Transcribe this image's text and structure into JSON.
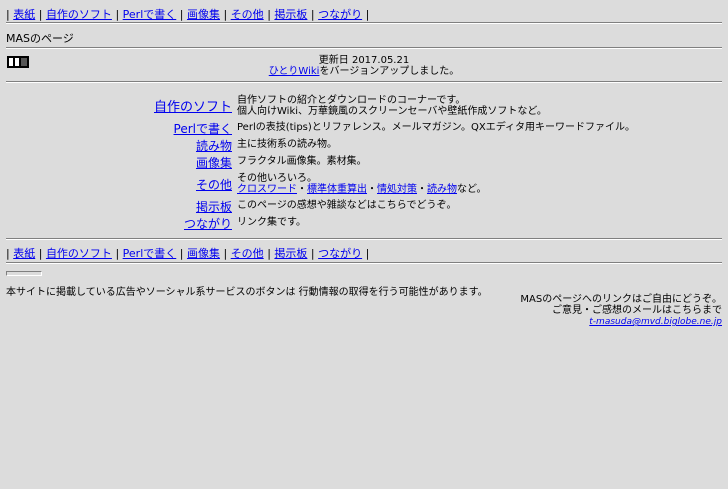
{
  "nav": {
    "items": [
      "表紙",
      "自作のソフト",
      "Perlで書く",
      "画像集",
      "その他",
      "掲示板",
      "つながり"
    ],
    "separator": "|"
  },
  "page_title": "MASのページ",
  "update": {
    "date_line": "更新日 2017.05.21",
    "link_text": "ひとりWiki",
    "message_rest": "をバージョンアップしました。"
  },
  "sections": [
    {
      "label": "自作のソフト",
      "lines": [
        "自作ソフトの紹介とダウンロードのコーナーです。",
        "個人向けWiki、万華鏡風のスクリーンセーバや壁紙作成ソフトなど。"
      ]
    },
    {
      "label": "Perlで書く",
      "lines": [
        "Perlの表技(tips)とリファレンス。メールマガジン。QXエディタ用キーワードファイル。"
      ]
    },
    {
      "label": "読み物",
      "lines": [
        "主に技術系の読み物。"
      ]
    },
    {
      "label": "画像集",
      "lines": [
        "フラクタル画像集。素材集。"
      ]
    },
    {
      "label": "その他",
      "lines": [
        "その他いろいろ。"
      ],
      "sublinks": [
        "クロスワード",
        "標準体重算出",
        "情処対策",
        "読み物"
      ],
      "sublink_sep": "・",
      "suffix": "など。"
    },
    {
      "label": "掲示板",
      "lines": [
        "このページの感想や雑談などはこちらでどうぞ。"
      ]
    },
    {
      "label": "つながり",
      "lines": [
        "リンク集です。"
      ]
    }
  ],
  "disclaimer": "本サイトに掲載している広告やソーシャル系サービスのボタンは 行動情報の取得を行う可能性があります。",
  "contact": {
    "line1": "MASのページへのリンクはご自由にどうぞ。",
    "line2": "ご意見・ご感想のメールはこちらまで",
    "email": "t-masuda@mvd.biglobe.ne.jp"
  }
}
